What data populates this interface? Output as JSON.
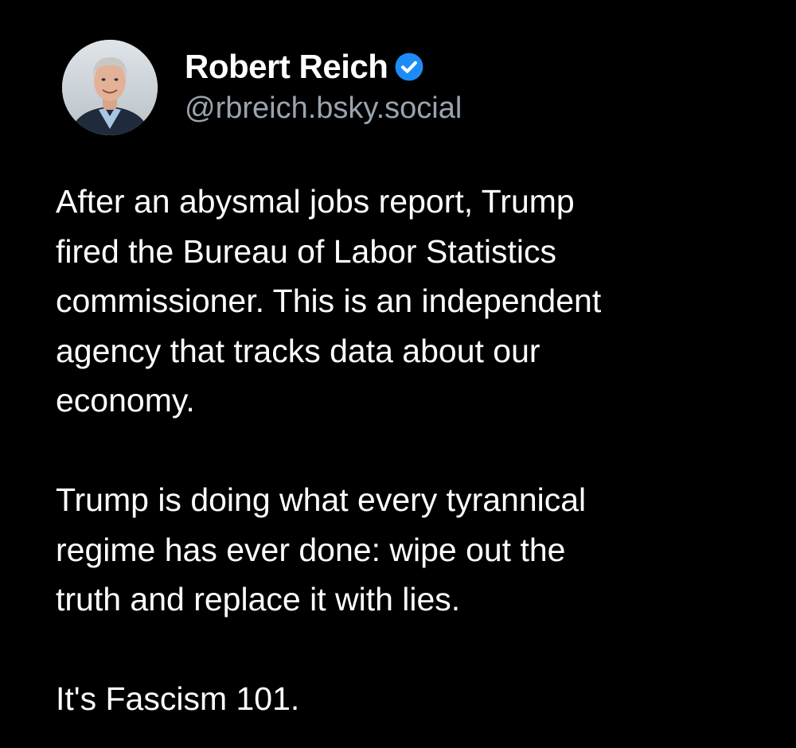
{
  "post": {
    "author": {
      "display_name": "Robert Reich",
      "handle": "@rbreich.bsky.social",
      "verified": true,
      "avatar_icon": "profile-photo"
    },
    "paragraphs": [
      "After an abysmal jobs report, Trump\nfired the Bureau of Labor Statistics\ncommissioner. This is an independent\nagency that tracks data about our\neconomy.",
      "Trump is doing what every tyrannical\nregime has ever done: wipe out the\ntruth and replace it with lies.",
      "It's Fascism 101."
    ]
  },
  "colors": {
    "background": "#000000",
    "text": "#ffffff",
    "handle": "#9aa4b0",
    "verified_badge": "#1d8cf8"
  }
}
